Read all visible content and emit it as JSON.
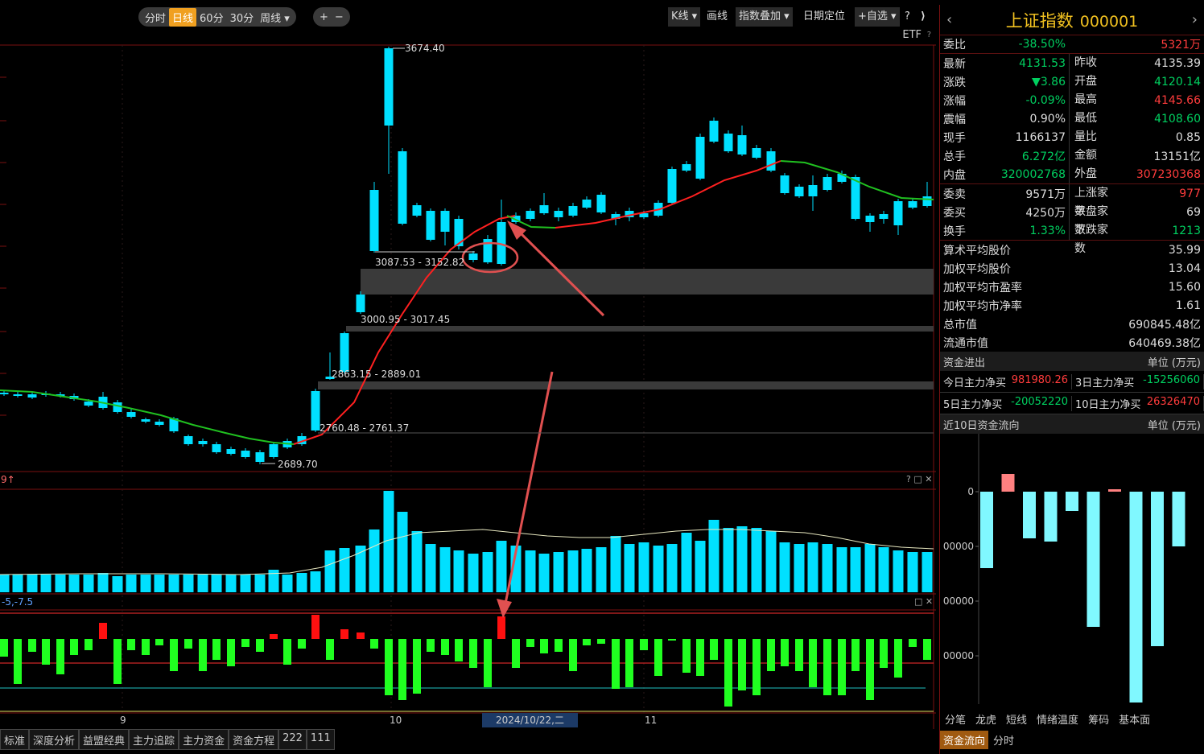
{
  "toolbar": {
    "periods": [
      "分时",
      "日线",
      "60分",
      "30分",
      "周线"
    ],
    "active_period": "日线",
    "zoom_in": "+",
    "zoom_out": "−",
    "kline": "K线",
    "draw": "画线",
    "overlay": "指数叠加",
    "locate": "日期定位",
    "watch": "+自选",
    "help": "?",
    "close": "⟩"
  },
  "chart": {
    "etf": "ETF",
    "etf_help": "?",
    "price_labels": {
      "high": "3674.40",
      "gap1": "3087.53 - 3152.82",
      "gap2": "3000.95 - 3017.45",
      "gap3": "2863.15 - 2889.01",
      "gap4": "2760.48 - 2761.37",
      "low": "2689.70"
    },
    "volume_panel_label": "9↑",
    "volume_panel_icons": "? □ ✕",
    "indicator_label": "-5,-7.5",
    "indicator_icons": "□ ✕",
    "x_labels": [
      "9",
      "10",
      "11"
    ],
    "cursor_date": "2024/10/22,二"
  },
  "bottom_tabs": [
    "标准",
    "深度分析",
    "益盟经典",
    "主力追踪",
    "主力资金",
    "资金方程",
    "222",
    "111"
  ],
  "panel": {
    "title": "上证指数",
    "code": "000001",
    "nav_left": "‹",
    "nav_right": "›",
    "weibi": {
      "label": "委比",
      "value": "-38.50%",
      "right": "5321万"
    },
    "quote": [
      {
        "l1": "最新",
        "v1": "4131.53",
        "c1": "grn",
        "l2": "昨收",
        "v2": "4135.39",
        "c2": "wht"
      },
      {
        "l1": "涨跌",
        "v1": "▼3.86",
        "c1": "grn",
        "l2": "开盘",
        "v2": "4120.14",
        "c2": "grn"
      },
      {
        "l1": "涨幅",
        "v1": "-0.09%",
        "c1": "grn",
        "l2": "最高",
        "v2": "4145.66",
        "c2": "red"
      },
      {
        "l1": "震幅",
        "v1": "0.90%",
        "c1": "wht",
        "l2": "最低",
        "v2": "4108.60",
        "c2": "grn"
      },
      {
        "l1": "现手",
        "v1": "1166137",
        "c1": "wht",
        "l2": "量比",
        "v2": "0.85",
        "c2": "wht"
      },
      {
        "l1": "总手",
        "v1": "6.272亿",
        "c1": "grn",
        "l2": "金额",
        "v2": "13151亿",
        "c2": "wht"
      },
      {
        "l1": "内盘",
        "v1": "320002768",
        "c1": "grn",
        "l2": "外盘",
        "v2": "307230368",
        "c2": "red"
      }
    ],
    "quote2": [
      {
        "l1": "委卖",
        "v1": "9571万",
        "c1": "wht",
        "l2": "上涨家数",
        "v2": "977",
        "c2": "red"
      },
      {
        "l1": "委买",
        "v1": "4250万",
        "c1": "wht",
        "l2": "平盘家数",
        "v2": "69",
        "c2": "wht"
      },
      {
        "l1": "换手",
        "v1": "1.33%",
        "c1": "grn",
        "l2": "下跌家数",
        "v2": "1213",
        "c2": "grn"
      }
    ],
    "stats": [
      {
        "label": "算术平均股价",
        "value": "35.99"
      },
      {
        "label": "加权平均股价",
        "value": "13.04"
      },
      {
        "label": "加权平均市盈率",
        "value": "15.60"
      },
      {
        "label": "加权平均市净率",
        "value": "1.61"
      },
      {
        "label": "总市值",
        "value": "690845.48亿"
      },
      {
        "label": "流通市值",
        "value": "640469.38亿"
      }
    ],
    "flow_header": {
      "title": "资金进出",
      "unit": "单位 (万元)"
    },
    "flows": [
      {
        "l": "今日主力净买",
        "v": "981980.26",
        "c": "red"
      },
      {
        "l": "3日主力净买",
        "v": "-15256060",
        "c": "grn"
      },
      {
        "l": "5日主力净买",
        "v": "-20052220",
        "c": "grn"
      },
      {
        "l": "10日主力净买",
        "v": "26326470",
        "c": "red"
      }
    ],
    "flow10_header": {
      "title": "近10日资金流向",
      "unit": "单位 (万元)"
    },
    "flow10_ticks": [
      "0",
      "00000",
      "00000",
      "00000"
    ],
    "tabs_row1": [
      "分笔",
      "龙虎",
      "短线",
      "情绪温度",
      "筹码",
      "基本面"
    ],
    "tabs_row2": [
      "资金流向",
      "分时"
    ],
    "active_tab": "资金流向"
  },
  "colors": {
    "up": "#ff3c3c",
    "down": "#00e0ff",
    "ma_red": "#ff2020",
    "ma_green": "#20c020",
    "ind_up": "#ff1010",
    "ind_down": "#20ff20",
    "accent": "#f0a020"
  }
}
